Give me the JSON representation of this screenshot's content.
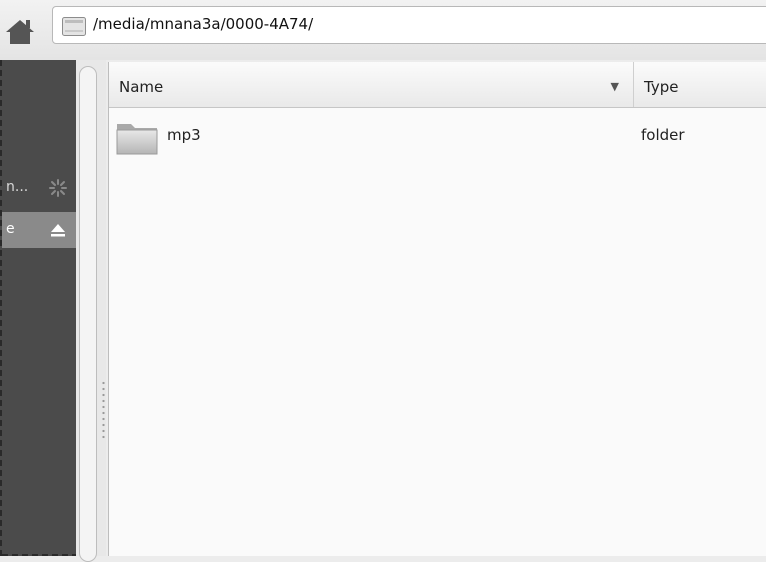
{
  "location": {
    "path": "/media/mnana3a/0000-4A74/"
  },
  "sidebar": {
    "items": [
      {
        "label": "n...",
        "icon": "spinner-icon"
      },
      {
        "label": "e",
        "icon": "eject-icon"
      }
    ]
  },
  "columns": {
    "name": "Name",
    "type": "Type",
    "sort_indicator": "▼"
  },
  "files": [
    {
      "name": "mp3",
      "type": "folder",
      "icon": "folder-icon"
    }
  ]
}
